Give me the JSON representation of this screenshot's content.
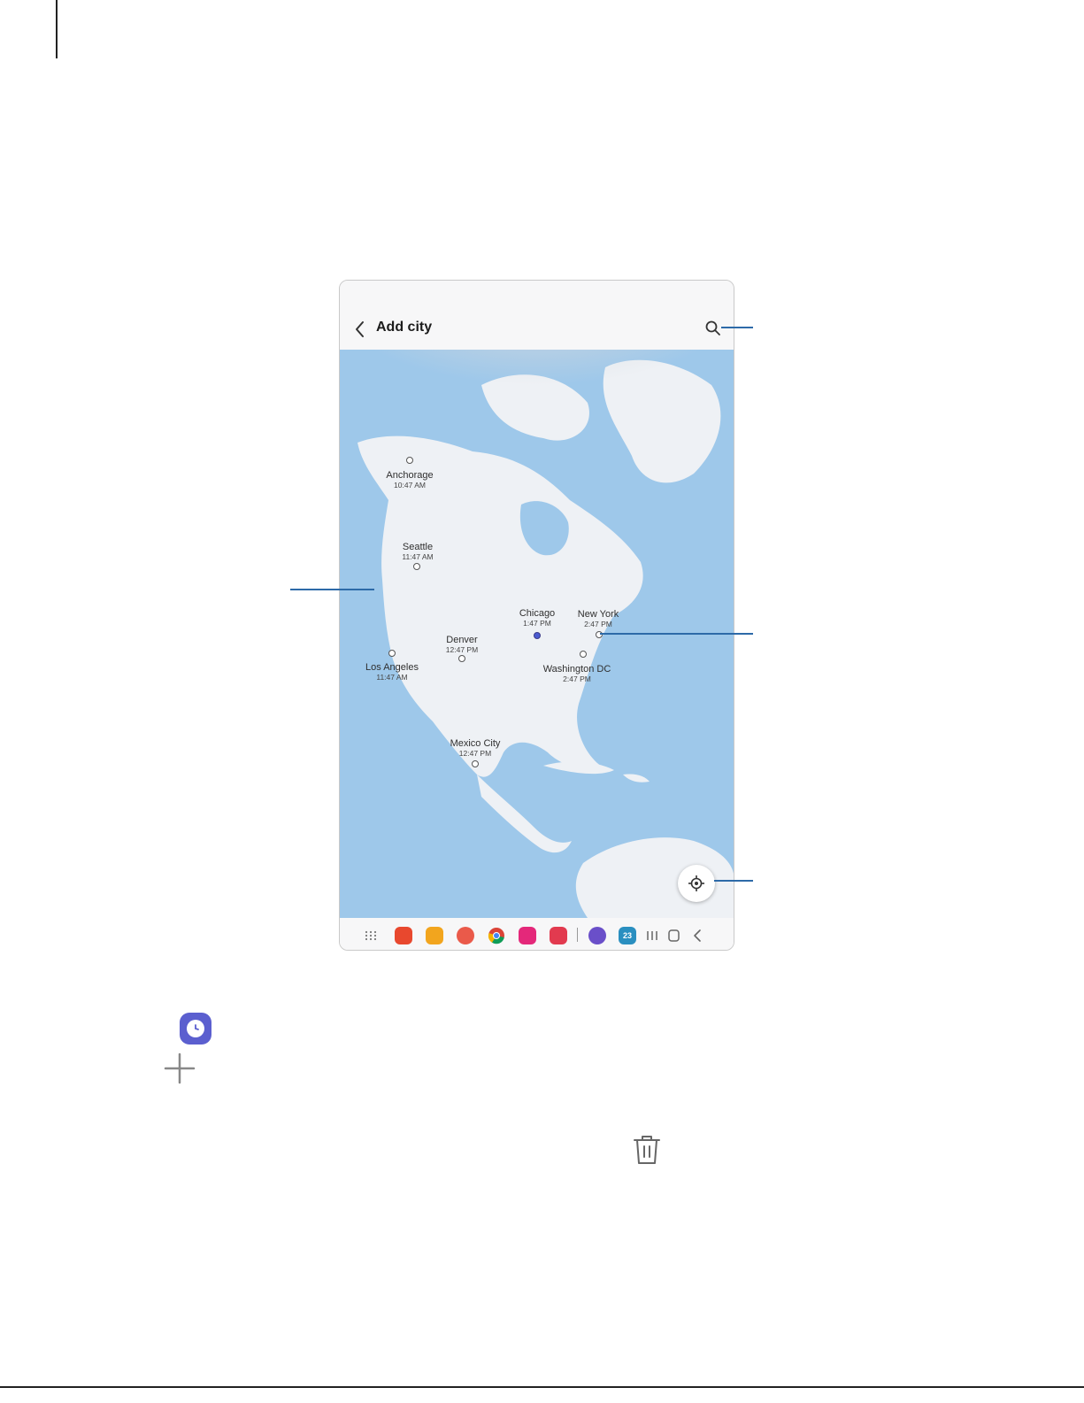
{
  "app": {
    "title": "Add city"
  },
  "cities": [
    {
      "name": "Anchorage",
      "time": "10:47 AM",
      "selected": false
    },
    {
      "name": "Seattle",
      "time": "11:47 AM",
      "selected": false
    },
    {
      "name": "Chicago",
      "time": "1:47 PM",
      "selected": true
    },
    {
      "name": "New York",
      "time": "2:47 PM",
      "selected": false
    },
    {
      "name": "Denver",
      "time": "12:47 PM",
      "selected": false
    },
    {
      "name": "Los Angeles",
      "time": "11:47 AM",
      "selected": false
    },
    {
      "name": "Washington DC",
      "time": "2:47 PM",
      "selected": false
    },
    {
      "name": "Mexico City",
      "time": "12:47 PM",
      "selected": false
    }
  ],
  "taskbar": {
    "calendar_day": "23",
    "apps": [
      "apps-grid-icon",
      "notes-icon",
      "my-files-icon",
      "contacts-icon",
      "chrome-icon",
      "gallery-icon",
      "camera-icon",
      "internet-icon",
      "calendar-icon"
    ]
  },
  "icons": {
    "back": "back-arrow-icon",
    "search": "search-icon",
    "locate": "my-location-icon",
    "clock": "clock-app-icon",
    "plus": "plus-icon",
    "trash": "trash-icon"
  },
  "colors": {
    "ocean": "#9ec8ea",
    "land": "#eef1f5",
    "space": "#2f4791",
    "callout": "#2d6aa8",
    "clock_app": "#5b5fcf"
  }
}
